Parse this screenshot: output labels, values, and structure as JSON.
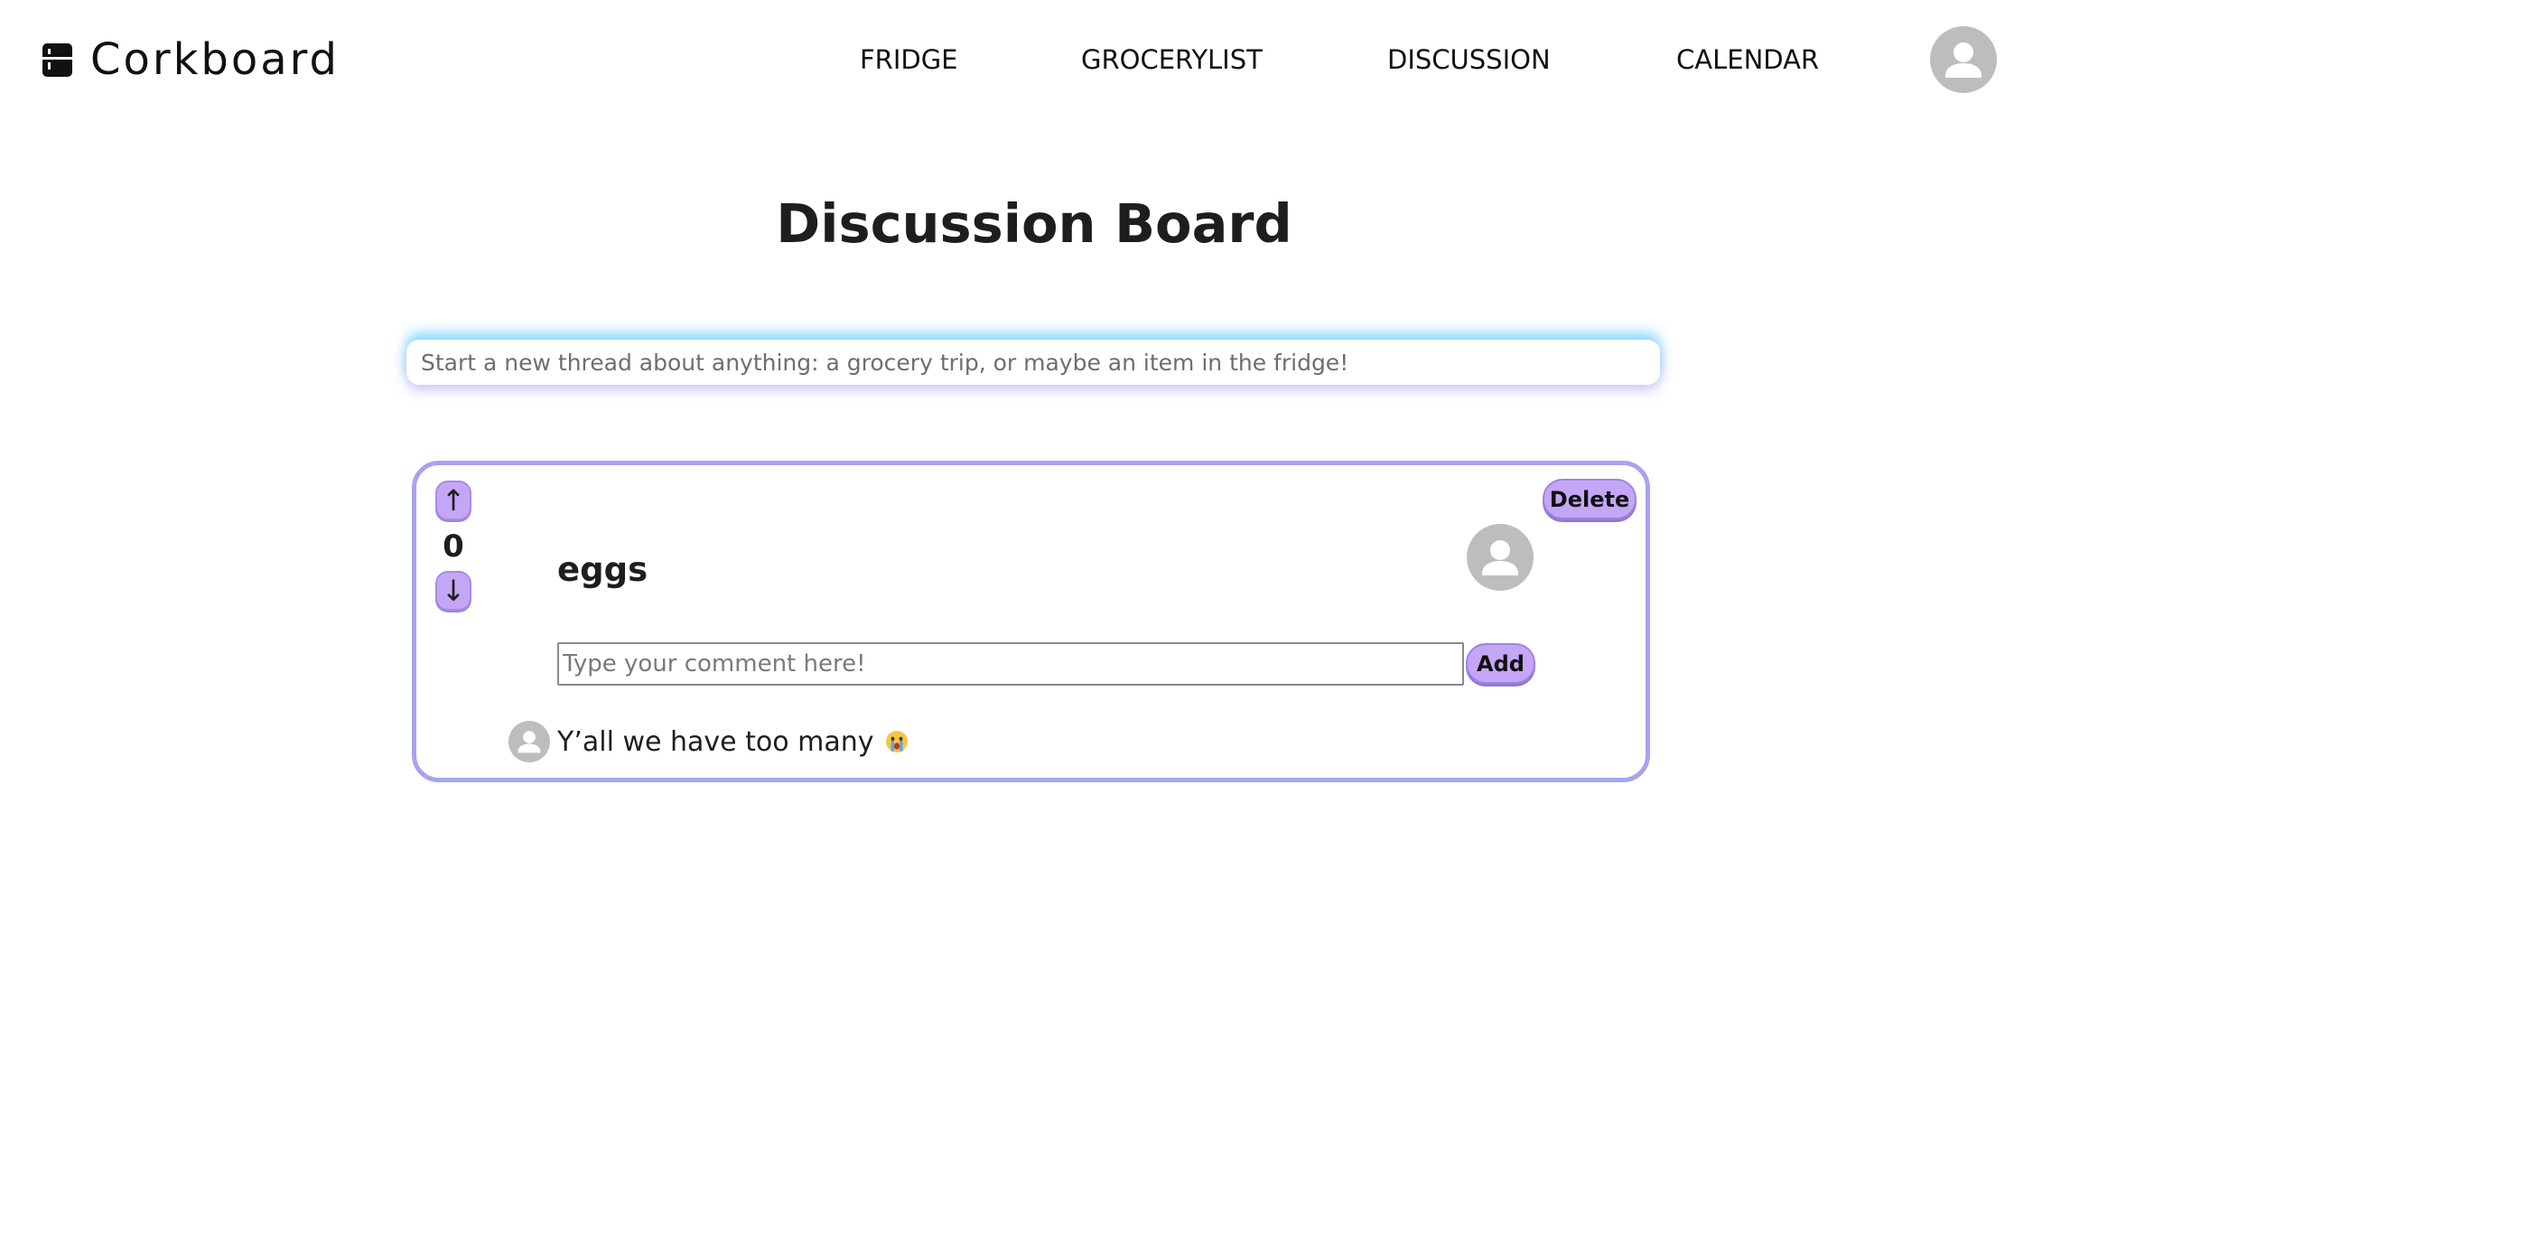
{
  "brand": {
    "name": "Corkboard",
    "icon": "fridge-icon"
  },
  "nav": {
    "items": [
      {
        "label": "FRIDGE"
      },
      {
        "label": "GROCERYLIST"
      },
      {
        "label": "DISCUSSION"
      },
      {
        "label": "CALENDAR"
      }
    ],
    "profile_icon": "user-avatar-icon"
  },
  "page": {
    "title": "Discussion Board"
  },
  "new_thread": {
    "placeholder": "Start a new thread about anything: a grocery trip, or maybe an item in the fridge!",
    "value": ""
  },
  "threads": [
    {
      "title": "eggs",
      "votes": "0",
      "upvote_label": "↑",
      "downvote_label": "↓",
      "delete_label": "Delete",
      "comment_placeholder": "Type your comment here!",
      "add_label": "Add",
      "comments": [
        {
          "text": "Y’all we have too many",
          "emoji": "crying-face-emoji"
        }
      ]
    }
  ],
  "colors": {
    "accent_button": "#c5a6f6",
    "card_border": "#a7a3ef",
    "avatar_gray": "#bdbdbd"
  }
}
